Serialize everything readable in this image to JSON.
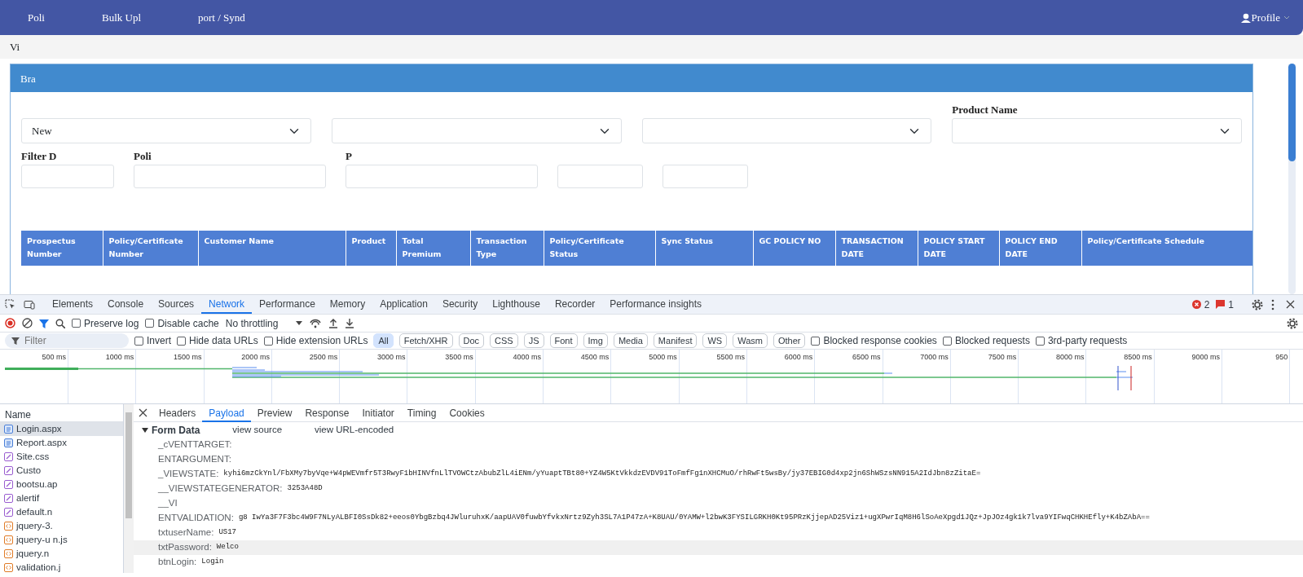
{
  "navbar": {
    "items": [
      "Poli",
      "Bulk Upl",
      "port / Synd"
    ],
    "profile": "Profile"
  },
  "breadcrumb": "Vi",
  "panel": {
    "title": "Bra",
    "row1": [
      {
        "kind": "select",
        "value": "New"
      },
      {
        "kind": "select"
      },
      {
        "kind": "select"
      },
      {
        "kind": "select",
        "label": "Product Name"
      }
    ],
    "row2": [
      {
        "kind": "input",
        "label": "Filter D"
      },
      {
        "kind": "input",
        "label": "Poli"
      },
      {
        "kind": "input",
        "label": "P"
      },
      {
        "kind": "input"
      },
      {
        "kind": "input"
      }
    ],
    "table": {
      "columns": [
        "Prospectus Number",
        "Policy/Certificate Number",
        "Customer Name",
        "Product",
        "Total Premium",
        "Transaction Type",
        "Policy/Certificate Status",
        "Sync Status",
        "GC POLICY NO",
        "TRANSACTION DATE",
        "POLICY START DATE",
        "POLICY END DATE",
        "Policy/Certificate Schedule"
      ]
    }
  },
  "devtools": {
    "tabs": [
      {
        "label": "Elements",
        "selected": false
      },
      {
        "label": "Console",
        "selected": false
      },
      {
        "label": "Sources",
        "selected": false
      },
      {
        "label": "Network",
        "selected": true
      },
      {
        "label": "Performance",
        "selected": false
      },
      {
        "label": "Memory",
        "selected": false
      },
      {
        "label": "Application",
        "selected": false
      },
      {
        "label": "Security",
        "selected": false
      },
      {
        "label": "Lighthouse",
        "selected": false
      },
      {
        "label": "Recorder",
        "selected": false
      },
      {
        "label": "Performance insights",
        "selected": false
      }
    ],
    "error_count": "2",
    "issue_count": "1",
    "toolbar": {
      "preserve_log": {
        "label": "Preserve log",
        "checked": false
      },
      "disable_cache": {
        "label": "Disable cache",
        "checked": false
      },
      "throttling": "No throttling"
    },
    "filter": {
      "placeholder": "Filter",
      "checkboxes_left": [
        {
          "label": "Invert",
          "checked": false
        },
        {
          "label": "Hide data URLs",
          "checked": false
        },
        {
          "label": "Hide extension URLs",
          "checked": false
        }
      ],
      "types": [
        {
          "label": "All",
          "selected": true
        },
        {
          "label": "Fetch/XHR",
          "selected": false
        },
        {
          "label": "Doc",
          "selected": false
        },
        {
          "label": "CSS",
          "selected": false
        },
        {
          "label": "JS",
          "selected": false
        },
        {
          "label": "Font",
          "selected": false
        },
        {
          "label": "Img",
          "selected": false
        },
        {
          "label": "Media",
          "selected": false
        },
        {
          "label": "Manifest",
          "selected": false
        },
        {
          "label": "WS",
          "selected": false
        },
        {
          "label": "Wasm",
          "selected": false
        },
        {
          "label": "Other",
          "selected": false
        }
      ],
      "checkboxes_right": [
        {
          "label": "Blocked response cookies",
          "checked": false
        },
        {
          "label": "Blocked requests",
          "checked": false
        },
        {
          "label": "3rd-party requests",
          "checked": false
        }
      ]
    },
    "timeline_ticks": [
      "500 ms",
      "1000 ms",
      "1500 ms",
      "2000 ms",
      "2500 ms",
      "3000 ms",
      "3500 ms",
      "4000 ms",
      "4500 ms",
      "5000 ms",
      "5500 ms",
      "6000 ms",
      "6500 ms",
      "7000 ms",
      "7500 ms",
      "8000 ms",
      "8500 ms",
      "9000 ms",
      "950"
    ],
    "name_header": "Name",
    "requests": [
      {
        "name": "Login.aspx",
        "kind": "doc",
        "selected": true
      },
      {
        "name": "Report.aspx",
        "kind": "doc",
        "selected": false
      },
      {
        "name": "Site.css",
        "kind": "css",
        "selected": false
      },
      {
        "name": "Custo",
        "kind": "css",
        "selected": false
      },
      {
        "name": "bootsu.ap",
        "kind": "css",
        "selected": false
      },
      {
        "name": "alertif",
        "kind": "css",
        "selected": false
      },
      {
        "name": "default.n",
        "kind": "css",
        "selected": false
      },
      {
        "name": "jquery-3.",
        "kind": "script",
        "selected": false
      },
      {
        "name": "jquery-u n.js",
        "kind": "script",
        "selected": false
      },
      {
        "name": "jquery.n",
        "kind": "script",
        "selected": false
      },
      {
        "name": "validation.j",
        "kind": "script",
        "selected": false
      }
    ],
    "detail_tabs": [
      {
        "label": "Headers",
        "selected": false
      },
      {
        "label": "Payload",
        "selected": true
      },
      {
        "label": "Preview",
        "selected": false
      },
      {
        "label": "Response",
        "selected": false
      },
      {
        "label": "Initiator",
        "selected": false
      },
      {
        "label": "Timing",
        "selected": false
      },
      {
        "label": "Cookies",
        "selected": false
      }
    ],
    "form_data": {
      "title": "Form Data",
      "links": [
        "view source",
        "view URL-encoded"
      ],
      "rows": [
        {
          "key": "_cVENTTARGET:",
          "highlighted": false
        },
        {
          "key": "ENTARGUMENT:",
          "highlighted": false
        },
        {
          "key": "_VIEWSTATE:",
          "value": "kyhi6mzCkYnl/FbXMy7byVqe+W4pWEVmfr5T3RwyF1bHINVfnLlTVOWCtzAbubZlL4iENm/yYuaptTBt80+YZ4W5KtVkkdzEVDV91ToFmfFg1nXHCMuO/rhRwFt5wsBy/jy37EBIG0d4xp2jn6ShWSzsNN915A2IdJbn8zZitaE=",
          "highlighted": false
        },
        {
          "key": "__VIEWSTATEGENERATOR:",
          "value": "3253A48D",
          "highlighted": false
        },
        {
          "key": "__VI",
          "highlighted": false
        },
        {
          "key": "ENTVALIDATION:",
          "value": "g8 IwYa3F7F3bc4W9F7NLyALBFI0SsDk82+eeos0YbgBzbq4JWluruhxK/aapUAV0fuwbYfvkxNrtz9Zyh3SL7A1P47zA+K8UAU/0YAMW+l2bwK3FYSILGRKH0Kt95PRzKjjepAD25Viz1+ugXPwrIqM8H6lSoAeXpgd1JQz+JpJOz4gk1k7lva9YIFwqCHKHEfly+K4bZAbA==",
          "highlighted": false
        },
        {
          "key": "txtuserName:",
          "value": "US17",
          "highlighted": false
        },
        {
          "key": "txtPassword:",
          "value": "Welco",
          "highlighted": true
        },
        {
          "key": "btnLogin:",
          "value": "Login",
          "highlighted": false
        }
      ]
    }
  }
}
